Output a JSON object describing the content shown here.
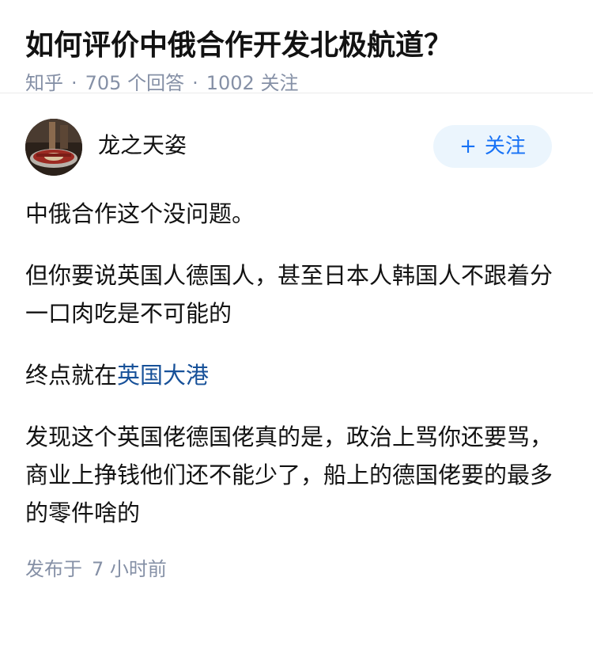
{
  "question": {
    "title": "如何评价中俄合作开发北极航道？",
    "source": "知乎",
    "answer_count": "705",
    "answer_label": "个回答",
    "follower_count": "1002",
    "follower_label": "关注"
  },
  "author": {
    "name": "龙之天姿",
    "follow_plus": "+",
    "follow_label": "关注"
  },
  "content": {
    "p1": "中俄合作这个没问题。",
    "p2": "但你要说英国人德国人，甚至日本人韩国人不跟着分一口肉吃是不可能的",
    "p3_prefix": "终点就在",
    "p3_link": "英国大港",
    "p4": "发现这个英国佬德国佬真的是，政治上骂你还要骂，商业上挣钱他们还不能少了，船上的德国佬要的最多的零件啥的"
  },
  "footer": {
    "publish_label": "发布于",
    "publish_time": "7 小时前"
  },
  "colors": {
    "meta": "#8590a6",
    "link": "#175199",
    "follow_bg": "#ebf5fd",
    "follow_text": "#1772f6"
  },
  "icons": {
    "avatar": "avatar-image"
  }
}
